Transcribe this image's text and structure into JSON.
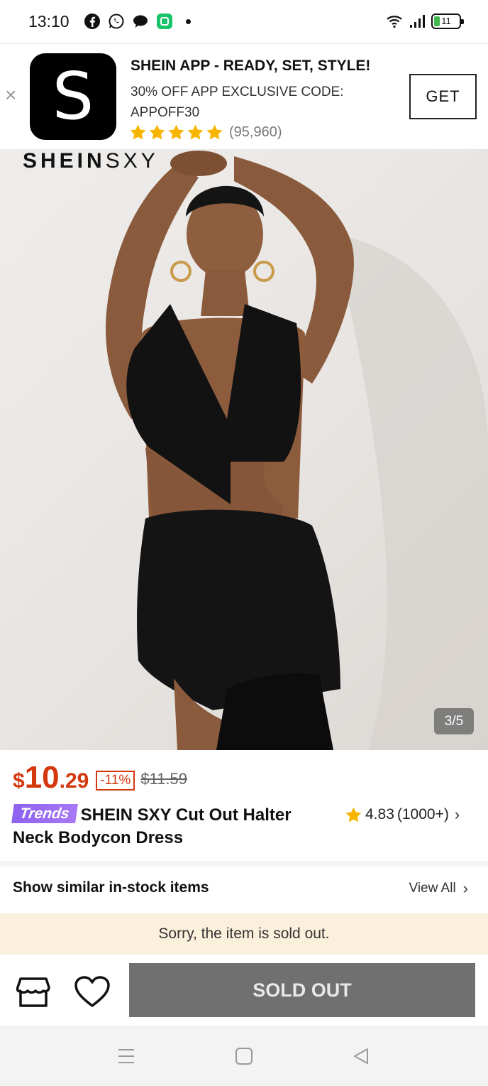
{
  "status_bar": {
    "time": "13:10",
    "battery": "11",
    "icons_left": [
      "facebook-icon",
      "whatsapp-icon",
      "chat-icon",
      "app-icon"
    ],
    "icons_right": [
      "wifi-icon",
      "signal-icon",
      "battery-icon"
    ]
  },
  "app_banner": {
    "close": "×",
    "logo_letter": "S",
    "title": "SHEIN APP - READY, SET, STYLE!",
    "subtitle": "30% OFF APP EXCLUSIVE CODE: APPOFF30",
    "rating_stars": 5,
    "rating_count": "(95,960)",
    "get_label": "GET"
  },
  "hero": {
    "brand_bold": "SHEIN",
    "brand_light": "SXY",
    "counter": "3/5"
  },
  "product": {
    "currency": "$",
    "price_main": "10",
    "price_cents": ".29",
    "discount": "-11%",
    "original_price": "$11.59",
    "badge": "Trends",
    "title": "SHEIN SXY Cut Out Halter Neck Bodycon Dress",
    "rating": "4.83",
    "rating_count": "(1000+)"
  },
  "similar": {
    "label": "Show similar in-stock items",
    "view_all": "View All"
  },
  "notice": "Sorry, the item is sold out.",
  "bottom_bar": {
    "sold_out_label": "SOLD OUT"
  },
  "colors": {
    "price": "#d4380d",
    "star": "#f7b500",
    "trends_badge": "#9a6cf2",
    "notice_bg": "#fbf0dc",
    "sold_out_bg": "#707070"
  }
}
